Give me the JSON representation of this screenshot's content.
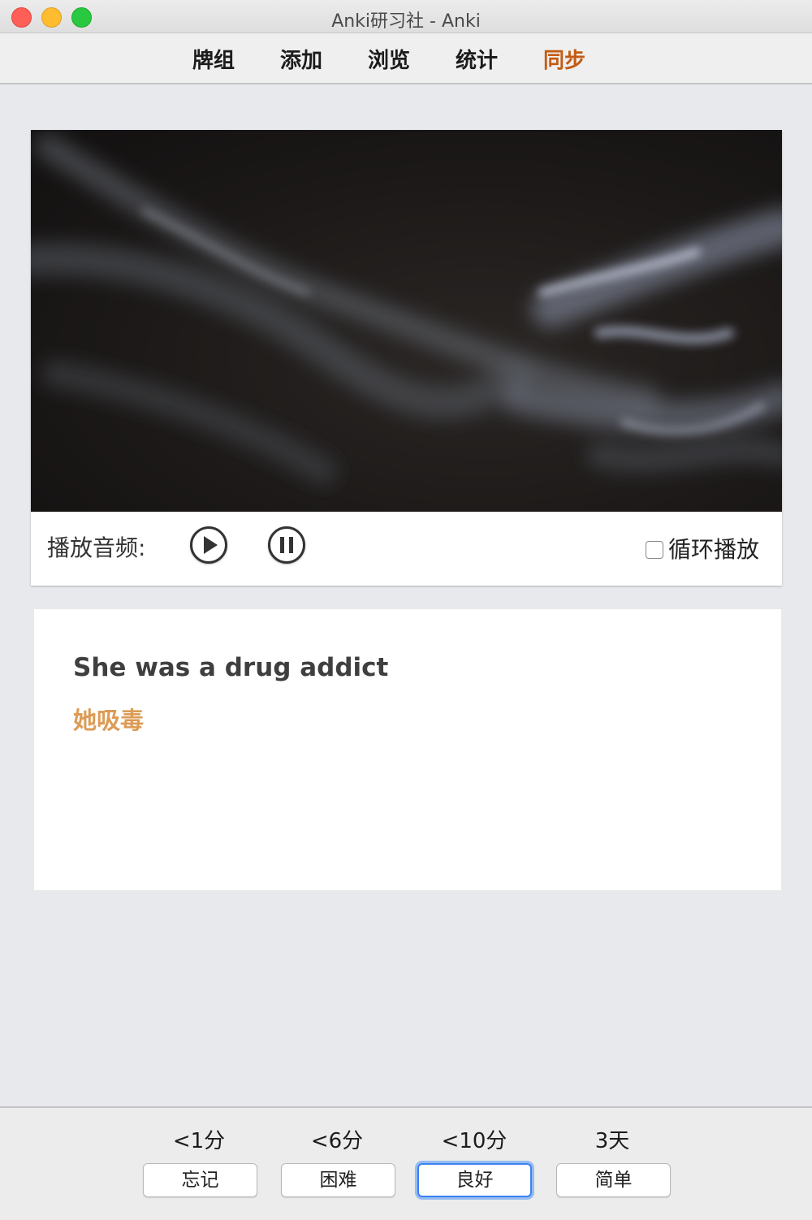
{
  "window": {
    "title": "Anki研习社 - Anki"
  },
  "toolbar": {
    "decks": "牌组",
    "add": "添加",
    "browse": "浏览",
    "stats": "统计",
    "sync": "同步"
  },
  "media": {
    "play_label": "播放音频:",
    "loop_label": "循环播放",
    "loop_checked": false
  },
  "card": {
    "english": "She was a drug addict",
    "chinese": "她吸毒"
  },
  "answers": [
    {
      "interval": "<1分",
      "label": "忘记"
    },
    {
      "interval": "<6分",
      "label": "困难"
    },
    {
      "interval": "<10分",
      "label": "良好"
    },
    {
      "interval": "3天",
      "label": "简单"
    }
  ],
  "colors": {
    "sync_accent": "#c35b13",
    "chinese_text": "#dc9c56",
    "focus_ring": "#3b82f0"
  },
  "icons": [
    "play-icon",
    "pause-icon"
  ]
}
